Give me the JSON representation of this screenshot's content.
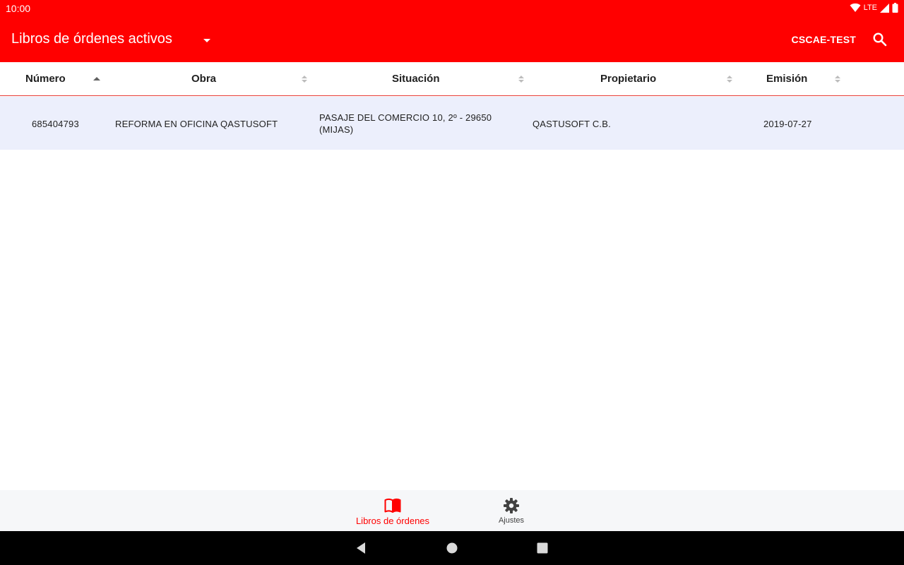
{
  "status_bar": {
    "time": "10:00",
    "network": "LTE",
    "icons": [
      "wifi-icon",
      "signal-icon",
      "battery-icon"
    ]
  },
  "app_bar": {
    "title": "Libros de órdenes activos",
    "account": "CSCAE-TEST",
    "icons": [
      "dropdown-arrow-icon",
      "search-icon"
    ],
    "color": "#ff0000"
  },
  "table": {
    "columns": [
      {
        "label": "Número",
        "sort": "ascending"
      },
      {
        "label": "Obra",
        "sort": "none"
      },
      {
        "label": "Situación",
        "sort": "none"
      },
      {
        "label": "Propietario",
        "sort": "none"
      },
      {
        "label": "Emisión",
        "sort": "none"
      }
    ],
    "rows": [
      {
        "numero": "685404793",
        "obra": "REFORMA EN OFICINA QASTUSOFT",
        "situacion_line1": "PASAJE DEL COMERCIO 10, 2º - 29650",
        "situacion_line2": "(MIJAS)",
        "propietario": "QASTUSOFT C.B.",
        "emision": "2019-07-27"
      }
    ],
    "row_highlight_color": "#eceffc"
  },
  "bottom_nav": {
    "items": [
      {
        "label": "Libros de órdenes",
        "icon": "book-icon",
        "active": true
      },
      {
        "label": "Ajustes",
        "icon": "gear-icon",
        "active": false
      }
    ],
    "active_color": "#ff0000"
  },
  "system_nav": {
    "icons": [
      "back-icon",
      "home-icon",
      "recents-icon"
    ]
  }
}
